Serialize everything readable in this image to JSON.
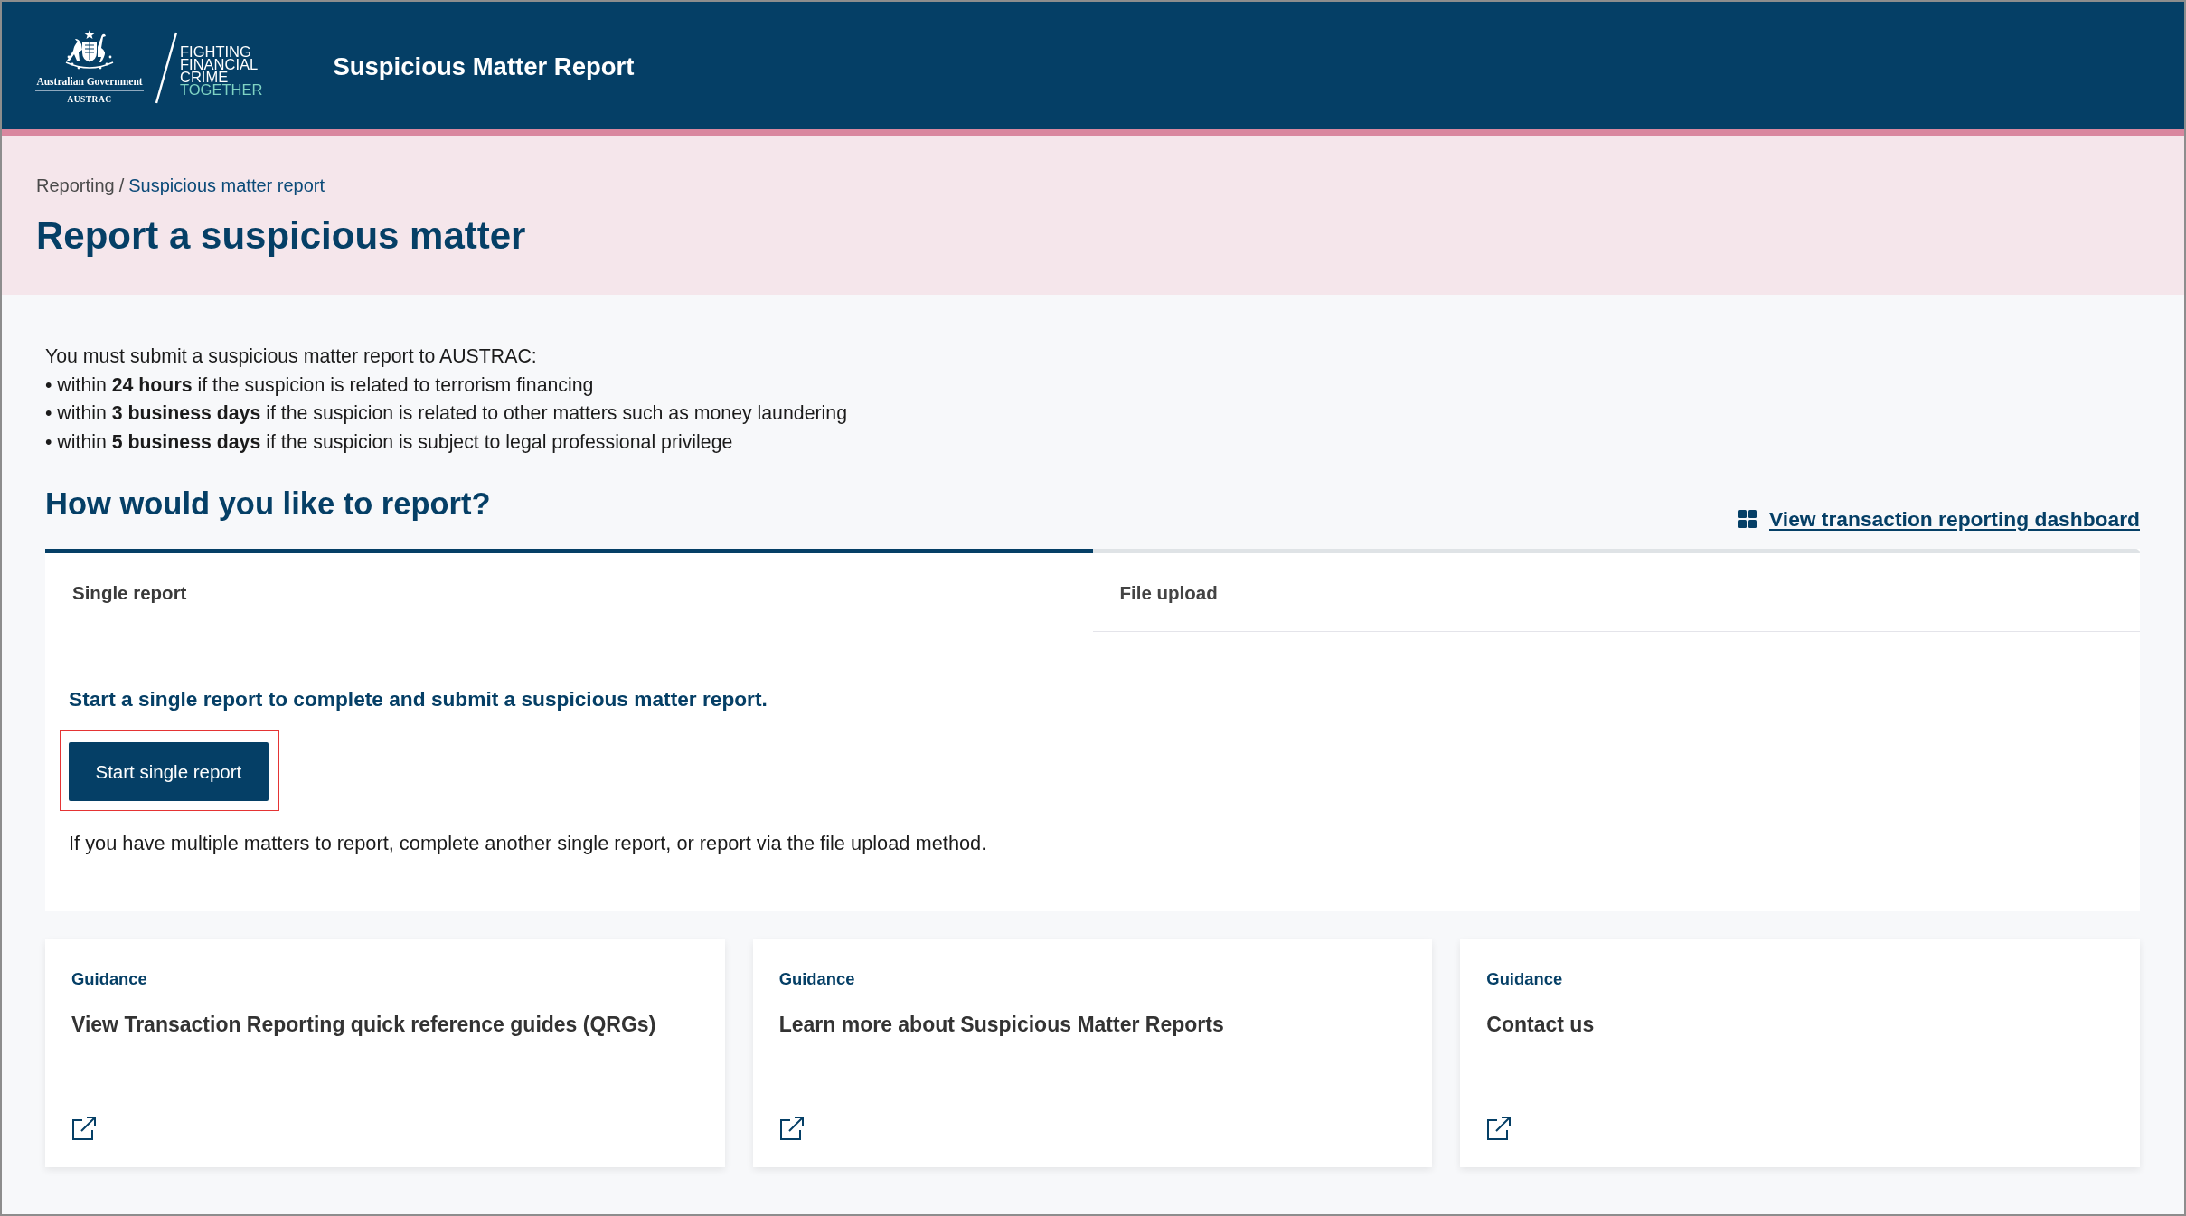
{
  "header": {
    "logo": {
      "government": "Australian Government",
      "agency": "AUSTRAC",
      "tagline": [
        "FIGHTING",
        "FINANCIAL",
        "CRIME"
      ],
      "tagline_accent": "TOGETHER"
    },
    "title": "Suspicious Matter Report"
  },
  "breadcrumb": {
    "items": [
      {
        "label": "Reporting",
        "kind": "parent"
      },
      {
        "label": "Suspicious matter report",
        "kind": "current"
      }
    ],
    "separator": "/"
  },
  "page_title": "Report a suspicious matter",
  "intro": {
    "lead": "You must submit a suspicious matter report to AUSTRAC:",
    "bullets": [
      "• within **24 hours** if the suspicion is related to terrorism financing",
      "• within **3 business days** if the suspicion is related to other matters such as money laundering",
      "• within **5 business days** if the suspicion is subject to legal professional privilege"
    ]
  },
  "report_section": {
    "heading": "How would you like to report?",
    "dashboard_link": "View transaction reporting dashboard",
    "tabs": [
      {
        "label": "Single report",
        "selected": true
      },
      {
        "label": "File upload",
        "selected": false
      }
    ],
    "panel": {
      "heading": "Start a single report to complete and submit a suspicious matter report.",
      "button": {
        "label": "Start single report",
        "highlighted": true
      },
      "note": "If you have multiple matters to report, complete another single report, or report via the file upload method."
    }
  },
  "guidance_cards": [
    {
      "category": "Guidance",
      "title": "View Transaction Reporting quick reference guides (QRGs)"
    },
    {
      "category": "Guidance",
      "title": "Learn more about Suspicious Matter Reports"
    },
    {
      "category": "Guidance",
      "title": "Contact us"
    }
  ]
}
